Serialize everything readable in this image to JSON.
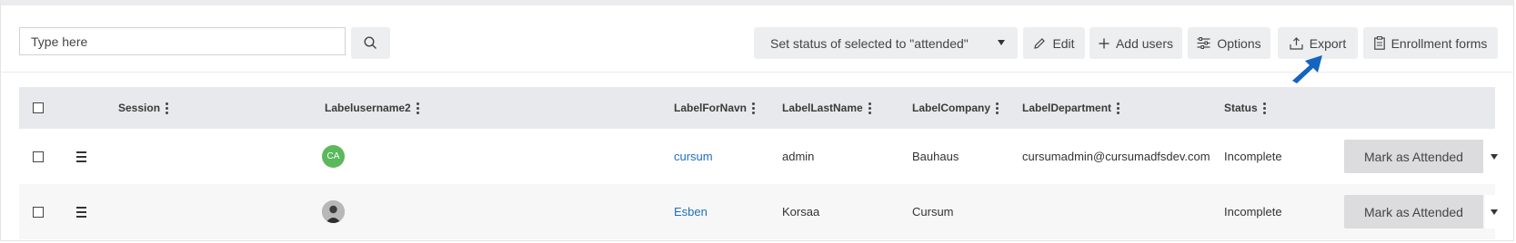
{
  "toolbar": {
    "search_placeholder": "Type here",
    "status_select_value": "Set status of selected to \"attended\"",
    "edit_label": "Edit",
    "add_users_label": "Add users",
    "options_label": "Options",
    "export_label": "Export",
    "enrollment_forms_label": "Enrollment forms"
  },
  "table": {
    "headers": {
      "session": "Session",
      "username": "Labelusername2",
      "first_name": "LabelForNavn",
      "last_name": "LabelLastName",
      "company": "LabelCompany",
      "department": "LabelDepartment",
      "status": "Status"
    },
    "rows": [
      {
        "avatar_initials": "CA",
        "first_name": "cursum",
        "last_name": "admin",
        "company": "Bauhaus",
        "department": "cursumadmin@cursumadfsdev.com",
        "status": "Incomplete",
        "action_label": "Mark as Attended"
      },
      {
        "avatar_initials": "",
        "first_name": "Esben",
        "last_name": "Korsaa",
        "company": "Cursum",
        "department": "",
        "status": "Incomplete",
        "action_label": "Mark as Attended"
      }
    ]
  },
  "colors": {
    "link": "#1f6fbf",
    "avatar_green": "#5cb85c",
    "annotation_arrow": "#1565c0",
    "header_bg": "#e8e9ec",
    "button_bg": "#eceef0"
  }
}
